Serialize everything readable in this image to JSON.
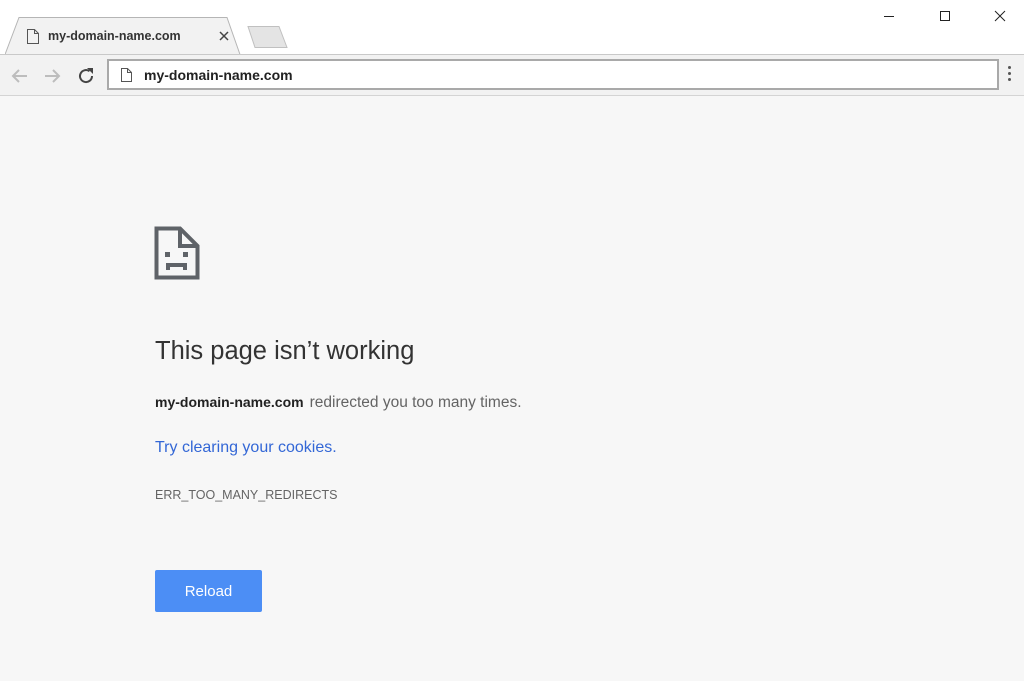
{
  "window": {
    "controls": [
      "minimize-icon",
      "maximize-icon",
      "close-icon"
    ]
  },
  "tab": {
    "title": "my-domain-name.com",
    "favicon": "page-icon"
  },
  "toolbar": {
    "icons": [
      "back-arrow-icon",
      "forward-arrow-icon",
      "reload-icon",
      "menu-dots-icon"
    ],
    "url": "my-domain-name.com"
  },
  "error": {
    "icon": "sad-page-icon",
    "title": "This page isn’t working",
    "domain": "my-domain-name.com",
    "message": "redirected you too many times.",
    "suggestion": "Try clearing your cookies.",
    "code": "ERR_TOO_MANY_REDIRECTS",
    "reload_label": "Reload"
  },
  "colors": {
    "page_background": "#f7f7f7",
    "link": "#3367d6",
    "button": "#4c8ef5"
  }
}
